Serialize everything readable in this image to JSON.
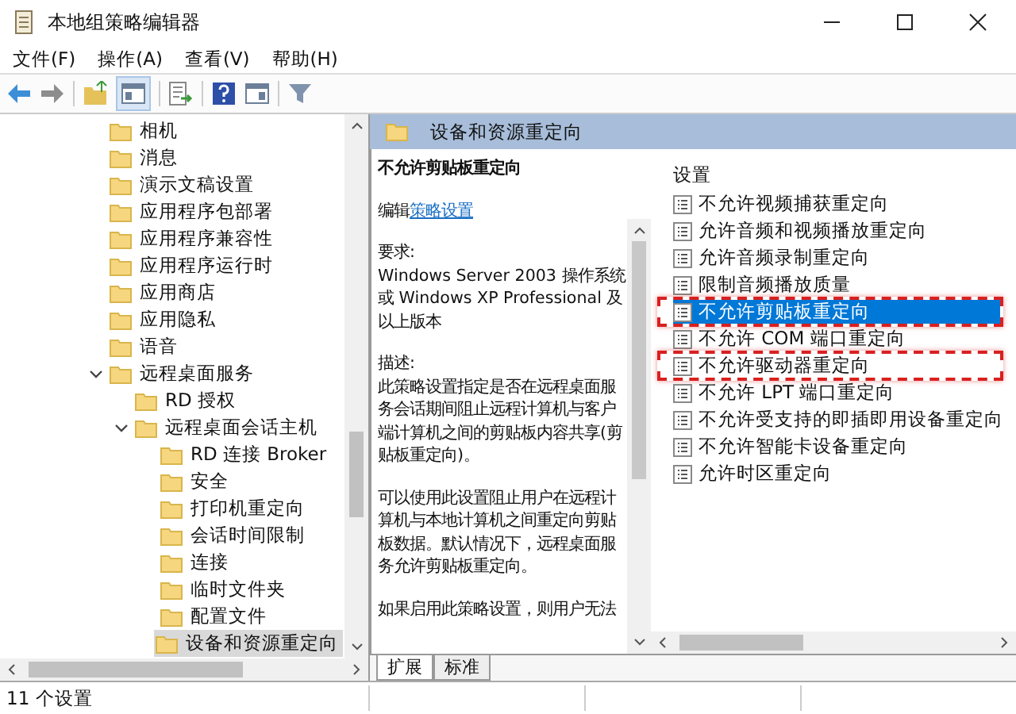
{
  "window": {
    "title": "本地组策略编辑器"
  },
  "menu": [
    "文件(F)",
    "操作(A)",
    "查看(V)",
    "帮助(H)"
  ],
  "tree": [
    {
      "label": "相机",
      "selected": false
    },
    {
      "label": "消息",
      "selected": false
    },
    {
      "label": "演示文稿设置",
      "selected": false
    },
    {
      "label": "应用程序包部署",
      "selected": false
    },
    {
      "label": "应用程序兼容性",
      "selected": false
    },
    {
      "label": "应用程序运行时",
      "selected": false
    },
    {
      "label": "应用商店",
      "selected": false
    },
    {
      "label": "应用隐私",
      "selected": false
    },
    {
      "label": "语音",
      "selected": false
    },
    {
      "label": "远程桌面服务",
      "selected": false,
      "expanded": true,
      "children": [
        {
          "label": "RD 授权",
          "selected": false
        },
        {
          "label": "远程桌面会话主机",
          "selected": false,
          "expanded": true,
          "children": [
            {
              "label": "RD 连接 Broker",
              "selected": false
            },
            {
              "label": "安全",
              "selected": false
            },
            {
              "label": "打印机重定向",
              "selected": false
            },
            {
              "label": "会话时间限制",
              "selected": false
            },
            {
              "label": "连接",
              "selected": false
            },
            {
              "label": "临时文件夹",
              "selected": false
            },
            {
              "label": "配置文件",
              "selected": false
            },
            {
              "label": "设备和资源重定向",
              "selected": true
            }
          ]
        }
      ]
    }
  ],
  "detail": {
    "header": "设备和资源重定向",
    "title": "不允许剪贴板重定向",
    "edit": {
      "prefix": "编辑",
      "link": "策略设置"
    },
    "paragraphs": [
      "要求:\nWindows Server 2003 操作系统或 Windows XP Professional 及以上版本",
      "描述:\n此策略设置指定是否在远程桌面服务会话期间阻止远程计算机与客户端计算机之间的剪贴板内容共享(剪贴板重定向)。",
      "可以使用此设置阻止用户在远程计算机与本地计算机之间重定向剪贴板数据。默认情况下，远程桌面服务允许剪贴板重定向。",
      "如果启用此策略设置，则用户无法"
    ]
  },
  "settings": {
    "heading": "设置",
    "items": [
      {
        "label": "不允许视频捕获重定向",
        "selected": false,
        "marked": false
      },
      {
        "label": "允许音频和视频播放重定向",
        "selected": false,
        "marked": false
      },
      {
        "label": "允许音频录制重定向",
        "selected": false,
        "marked": false
      },
      {
        "label": "限制音频播放质量",
        "selected": false,
        "marked": false
      },
      {
        "label": "不允许剪贴板重定向",
        "selected": true,
        "marked": true
      },
      {
        "label": "不允许 COM 端口重定向",
        "selected": false,
        "marked": false
      },
      {
        "label": "不允许驱动器重定向",
        "selected": false,
        "marked": true
      },
      {
        "label": "不允许 LPT 端口重定向",
        "selected": false,
        "marked": false
      },
      {
        "label": "不允许受支持的即插即用设备重定向",
        "selected": false,
        "marked": false
      },
      {
        "label": "不允许智能卡设备重定向",
        "selected": false,
        "marked": false
      },
      {
        "label": "允许时区重定向",
        "selected": false,
        "marked": false
      }
    ]
  },
  "tabs": [
    {
      "label": "扩展",
      "selected": true
    },
    {
      "label": "标准",
      "selected": false
    }
  ],
  "status_bar": "11 个设置"
}
